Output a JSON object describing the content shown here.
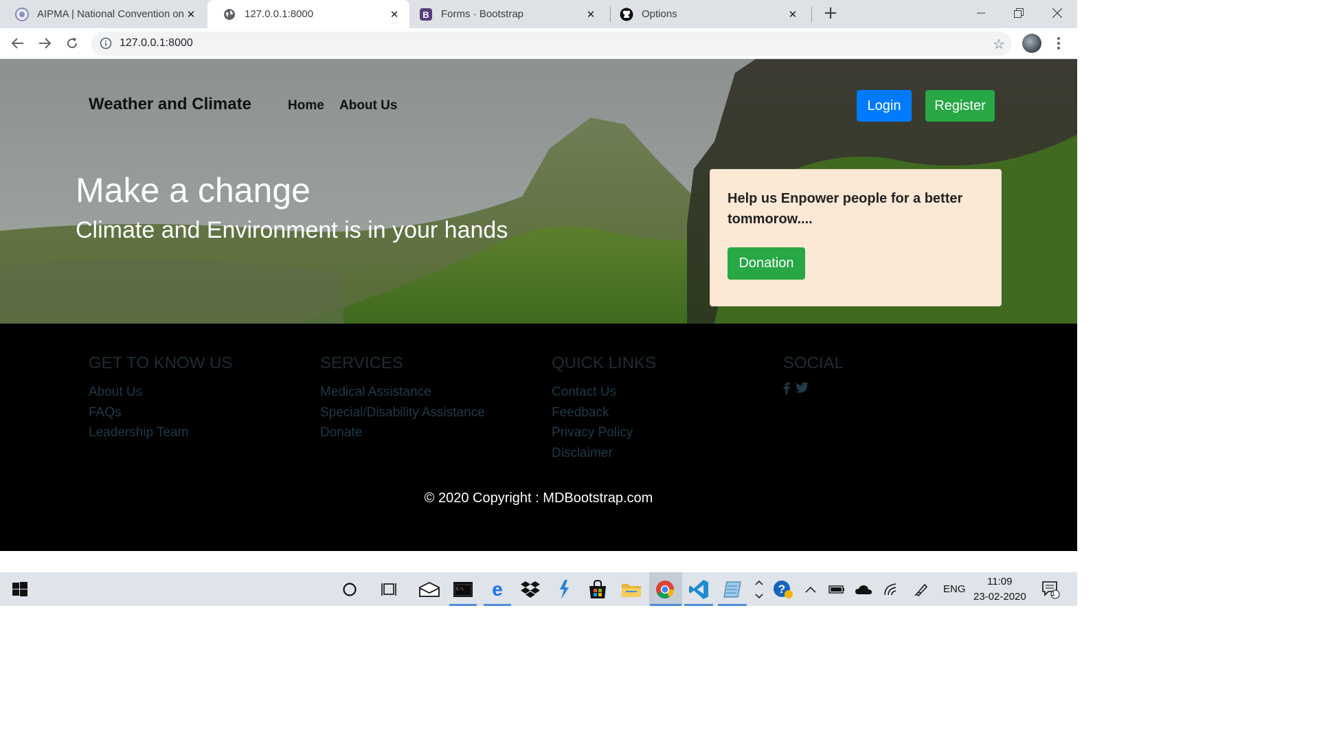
{
  "browser": {
    "tabs": [
      {
        "title": "AIPMA | National Convention on",
        "favicon": "aipma-logo-icon",
        "active": false
      },
      {
        "title": "127.0.0.1:8000",
        "favicon": "globe-icon",
        "active": true
      },
      {
        "title": "Forms · Bootstrap",
        "favicon": "bootstrap-b-icon",
        "active": false
      },
      {
        "title": "Options",
        "favicon": "github-icon",
        "active": false
      }
    ],
    "close_glyph": "✕",
    "new_tab_glyph": "+",
    "address": "127.0.0.1:8000"
  },
  "site": {
    "brand": "Weather and Climate",
    "nav": [
      "Home",
      "About Us"
    ],
    "login_label": "Login",
    "register_label": "Register",
    "hero_title": "Make a change",
    "hero_subtitle": "Climate and Environment is in your hands",
    "donate_text": "Help us Enpower people for a better tommorow....",
    "donation_label": "Donation",
    "colors": {
      "primary": "#007bff",
      "success": "#28a745",
      "card": "#fbe8d5"
    }
  },
  "footer": {
    "columns": [
      {
        "heading": "GET TO KNOW US",
        "links": [
          "About Us",
          "FAQs",
          "Leadership Team"
        ]
      },
      {
        "heading": "SERVICES",
        "links": [
          "Medical Assistance",
          "Special/Disability Assistance",
          "Donate"
        ]
      },
      {
        "heading": "QUICK LINKS",
        "links": [
          "Contact Us",
          "Feedback",
          "Privacy Policy",
          "Disclaimer"
        ]
      },
      {
        "heading": "SOCIAL",
        "links": []
      }
    ],
    "social_icons": [
      "facebook-icon",
      "twitter-icon"
    ],
    "copyright": "© 2020 Copyright : MDBootstrap.com"
  },
  "taskbar": {
    "apps": [
      "cortana-icon",
      "task-view-icon",
      "mail-icon",
      "terminal-icon",
      "edge-icon",
      "dropbox-icon",
      "visual-studio-icon",
      "store-icon",
      "file-explorer-icon",
      "chrome-icon",
      "vscode-icon",
      "notepad-icon"
    ],
    "language": "ENG",
    "time": "11:09",
    "date": "23-02-2020",
    "notifications": "1"
  }
}
